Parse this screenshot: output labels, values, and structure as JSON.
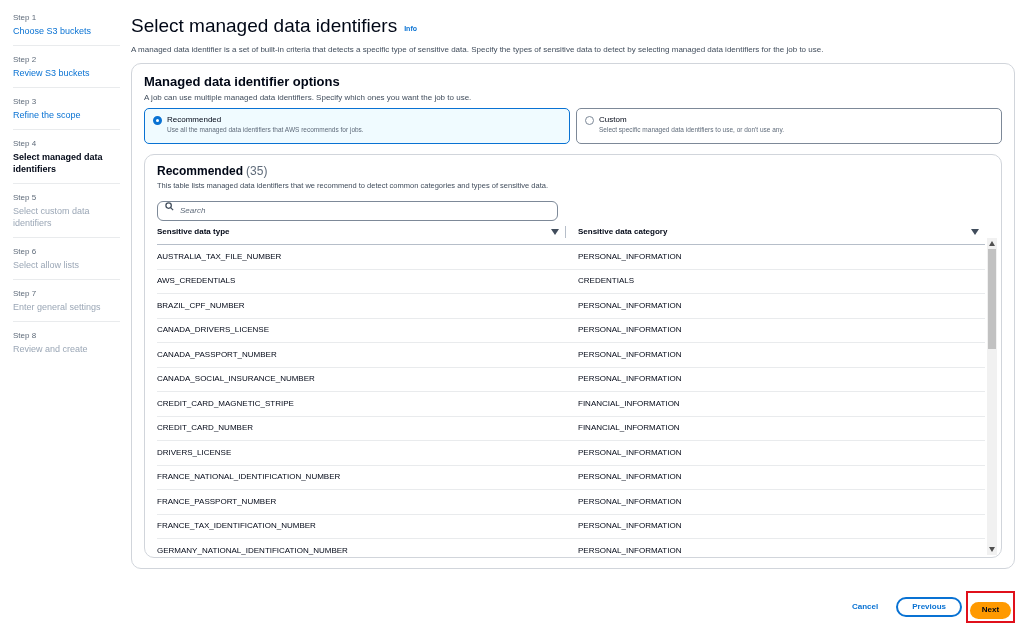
{
  "steps": [
    {
      "step": "Step 1",
      "label": "Choose S3 buckets",
      "selected": false,
      "disabled": false
    },
    {
      "step": "Step 2",
      "label": "Review S3 buckets",
      "selected": false,
      "disabled": false
    },
    {
      "step": "Step 3",
      "label": "Refine the scope",
      "selected": false,
      "disabled": false
    },
    {
      "step": "Step 4",
      "label": "Select managed data identifiers",
      "selected": true,
      "disabled": false
    },
    {
      "step": "Step 5",
      "label": "Select custom data identifiers",
      "selected": false,
      "disabled": true
    },
    {
      "step": "Step 6",
      "label": "Select allow lists",
      "selected": false,
      "disabled": true
    },
    {
      "step": "Step 7",
      "label": "Enter general settings",
      "selected": false,
      "disabled": true
    },
    {
      "step": "Step 8",
      "label": "Review and create",
      "selected": false,
      "disabled": true
    }
  ],
  "page": {
    "title": "Select managed data identifiers",
    "info": "Info",
    "description": "A managed data identifier is a set of built-in criteria that detects a specific type of sensitive data. Specify the types of sensitive data to detect by selecting managed data identifiers for the job to use."
  },
  "options": {
    "title": "Managed data identifier options",
    "description": "A job can use multiple managed data identifiers. Specify which ones you want the job to use.",
    "choices": [
      {
        "label": "Recommended",
        "description": "Use all the managed data identifiers that AWS recommends for jobs.",
        "selected": true
      },
      {
        "label": "Custom",
        "description": "Select specific managed data identifiers to use, or don't use any.",
        "selected": false
      }
    ]
  },
  "table": {
    "title": "Recommended",
    "count": "(35)",
    "description": "This table lists managed data identifiers that we recommend to detect common categories and types of sensitive data.",
    "search": {
      "placeholder": "Search"
    },
    "columns": [
      "Sensitive data type",
      "Sensitive data category"
    ],
    "rows": [
      [
        "AUSTRALIA_TAX_FILE_NUMBER",
        "PERSONAL_INFORMATION"
      ],
      [
        "AWS_CREDENTIALS",
        "CREDENTIALS"
      ],
      [
        "BRAZIL_CPF_NUMBER",
        "PERSONAL_INFORMATION"
      ],
      [
        "CANADA_DRIVERS_LICENSE",
        "PERSONAL_INFORMATION"
      ],
      [
        "CANADA_PASSPORT_NUMBER",
        "PERSONAL_INFORMATION"
      ],
      [
        "CANADA_SOCIAL_INSURANCE_NUMBER",
        "PERSONAL_INFORMATION"
      ],
      [
        "CREDIT_CARD_MAGNETIC_STRIPE",
        "FINANCIAL_INFORMATION"
      ],
      [
        "CREDIT_CARD_NUMBER",
        "FINANCIAL_INFORMATION"
      ],
      [
        "DRIVERS_LICENSE",
        "PERSONAL_INFORMATION"
      ],
      [
        "FRANCE_NATIONAL_IDENTIFICATION_NUMBER",
        "PERSONAL_INFORMATION"
      ],
      [
        "FRANCE_PASSPORT_NUMBER",
        "PERSONAL_INFORMATION"
      ],
      [
        "FRANCE_TAX_IDENTIFICATION_NUMBER",
        "PERSONAL_INFORMATION"
      ],
      [
        "GERMANY_NATIONAL_IDENTIFICATION_NUMBER",
        "PERSONAL_INFORMATION"
      ]
    ]
  },
  "footer": {
    "cancel": "Cancel",
    "previous": "Previous",
    "next": "Next",
    "next_highlighted": true
  }
}
